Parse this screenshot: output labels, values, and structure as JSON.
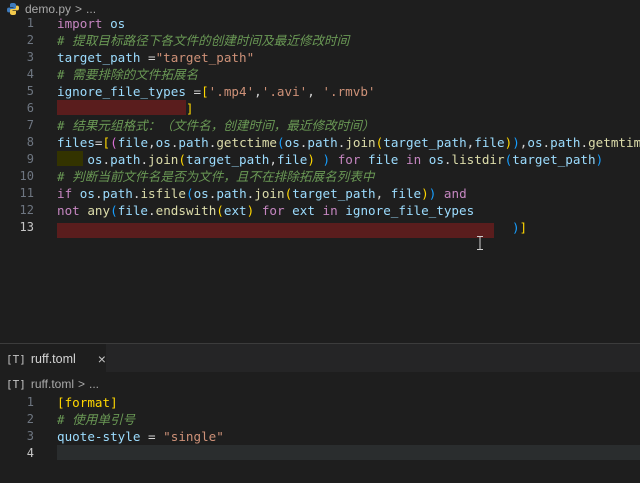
{
  "top_editor": {
    "breadcrumb": {
      "file": "demo.py",
      "sep": ">",
      "more": "..."
    },
    "lines": [
      {
        "n": "1",
        "segs": [
          [
            "kw",
            "import"
          ],
          [
            "pn",
            " "
          ],
          [
            "id",
            "os"
          ]
        ]
      },
      {
        "n": "2",
        "segs": [
          [
            "cm",
            "# 提取目标路径下各文件的创建时间及最近修改时间"
          ]
        ]
      },
      {
        "n": "3",
        "segs": [
          [
            "id",
            "target_path"
          ],
          [
            "pn",
            " ="
          ],
          [
            "str",
            "\"target_path\""
          ]
        ]
      },
      {
        "n": "4",
        "segs": [
          [
            "cm",
            "# 需要排除的文件拓展名"
          ]
        ]
      },
      {
        "n": "5",
        "segs": [
          [
            "id",
            "ignore_file_types"
          ],
          [
            "pn",
            " ="
          ],
          [
            "br1",
            "["
          ],
          [
            "str",
            "'.mp4'"
          ],
          [
            "pn",
            ","
          ],
          [
            "str",
            "'.avi'"
          ],
          [
            "pn",
            ", "
          ],
          [
            "str",
            "'.rmvb'"
          ]
        ]
      },
      {
        "n": "6",
        "segs": [
          [
            "pn",
            "                 "
          ],
          [
            "br1",
            "]"
          ]
        ]
      },
      {
        "n": "7",
        "segs": [
          [
            "cm",
            "# 结果元组格式：（文件名，创建时间，最近修改时间）"
          ]
        ]
      },
      {
        "n": "8",
        "segs": [
          [
            "id",
            "files"
          ],
          [
            "pn",
            "="
          ],
          [
            "br1",
            "["
          ],
          [
            "br2",
            "("
          ],
          [
            "id",
            "file"
          ],
          [
            "pn",
            ","
          ],
          [
            "id",
            "os"
          ],
          [
            "pn",
            "."
          ],
          [
            "id",
            "path"
          ],
          [
            "pn",
            "."
          ],
          [
            "fn",
            "getctime"
          ],
          [
            "br3",
            "("
          ],
          [
            "id",
            "os"
          ],
          [
            "pn",
            "."
          ],
          [
            "id",
            "path"
          ],
          [
            "pn",
            "."
          ],
          [
            "fn",
            "join"
          ],
          [
            "br1",
            "("
          ],
          [
            "id",
            "target_path"
          ],
          [
            "pn",
            ","
          ],
          [
            "id",
            "file"
          ],
          [
            "br1",
            ")"
          ],
          [
            "br3",
            ")"
          ],
          [
            "pn",
            ","
          ],
          [
            "id",
            "os"
          ],
          [
            "pn",
            "."
          ],
          [
            "id",
            "path"
          ],
          [
            "pn",
            "."
          ],
          [
            "fn",
            "getmtime"
          ],
          [
            "br3",
            "("
          ]
        ]
      },
      {
        "n": "9",
        "segs": [
          [
            "pn",
            "    "
          ],
          [
            "id",
            "os"
          ],
          [
            "pn",
            "."
          ],
          [
            "id",
            "path"
          ],
          [
            "pn",
            "."
          ],
          [
            "fn",
            "join"
          ],
          [
            "br1",
            "("
          ],
          [
            "id",
            "target_path"
          ],
          [
            "pn",
            ","
          ],
          [
            "id",
            "file"
          ],
          [
            "br1",
            ")"
          ],
          [
            "pn",
            " "
          ],
          [
            "br3",
            ")"
          ],
          [
            "pn",
            " "
          ],
          [
            "kw",
            "for"
          ],
          [
            "pn",
            " "
          ],
          [
            "id",
            "file"
          ],
          [
            "pn",
            " "
          ],
          [
            "kw",
            "in"
          ],
          [
            "pn",
            " "
          ],
          [
            "id",
            "os"
          ],
          [
            "pn",
            "."
          ],
          [
            "fn",
            "listdir"
          ],
          [
            "br3",
            "("
          ],
          [
            "id",
            "target_path"
          ],
          [
            "br3",
            ")"
          ]
        ]
      },
      {
        "n": "10",
        "segs": [
          [
            "cm",
            "# 判断当前文件名是否为文件，且不在排除拓展名列表中"
          ]
        ]
      },
      {
        "n": "11",
        "segs": [
          [
            "kw",
            "if"
          ],
          [
            "pn",
            " "
          ],
          [
            "id",
            "os"
          ],
          [
            "pn",
            "."
          ],
          [
            "id",
            "path"
          ],
          [
            "pn",
            "."
          ],
          [
            "fn",
            "isfile"
          ],
          [
            "br3",
            "("
          ],
          [
            "id",
            "os"
          ],
          [
            "pn",
            "."
          ],
          [
            "id",
            "path"
          ],
          [
            "pn",
            "."
          ],
          [
            "fn",
            "join"
          ],
          [
            "br1",
            "("
          ],
          [
            "id",
            "target_path"
          ],
          [
            "pn",
            ", "
          ],
          [
            "id",
            "file"
          ],
          [
            "br1",
            ")"
          ],
          [
            "br3",
            ")"
          ],
          [
            "pn",
            " "
          ],
          [
            "kw",
            "and"
          ]
        ]
      },
      {
        "n": "12",
        "segs": [
          [
            "kw",
            "not"
          ],
          [
            "pn",
            " "
          ],
          [
            "fn",
            "any"
          ],
          [
            "br3",
            "("
          ],
          [
            "id",
            "file"
          ],
          [
            "pn",
            "."
          ],
          [
            "fn",
            "endswith"
          ],
          [
            "br1",
            "("
          ],
          [
            "id",
            "ext"
          ],
          [
            "br1",
            ")"
          ],
          [
            "pn",
            " "
          ],
          [
            "kw",
            "for"
          ],
          [
            "pn",
            " "
          ],
          [
            "id",
            "ext"
          ],
          [
            "pn",
            " "
          ],
          [
            "kw",
            "in"
          ],
          [
            "pn",
            " "
          ],
          [
            "id",
            "ignore_file_types"
          ]
        ]
      },
      {
        "n": "13",
        "segs": [
          [
            "pn",
            "                                                            "
          ],
          [
            "br3",
            ")"
          ],
          [
            "br1",
            "]"
          ]
        ]
      }
    ]
  },
  "bottom_panel": {
    "tab": {
      "icon": "[T]",
      "label": "ruff.toml",
      "close": "×"
    },
    "breadcrumb": {
      "icon": "[T]",
      "file": "ruff.toml",
      "sep": ">",
      "more": "..."
    },
    "lines": [
      {
        "n": "1",
        "segs": [
          [
            "br1",
            "[format]"
          ]
        ]
      },
      {
        "n": "2",
        "segs": [
          [
            "cm",
            "# 使用单引号"
          ]
        ]
      },
      {
        "n": "3",
        "segs": [
          [
            "id",
            "quote-style"
          ],
          [
            "pn",
            " = "
          ],
          [
            "str",
            "\"single\""
          ]
        ]
      },
      {
        "n": "4",
        "segs": []
      }
    ]
  },
  "colors": {
    "background": "#1e1e1e",
    "keyword": "#c586c0",
    "string": "#ce9178",
    "comment": "#6a9955",
    "function": "#dcdcaa",
    "error_highlight": "#5a1d1d"
  }
}
